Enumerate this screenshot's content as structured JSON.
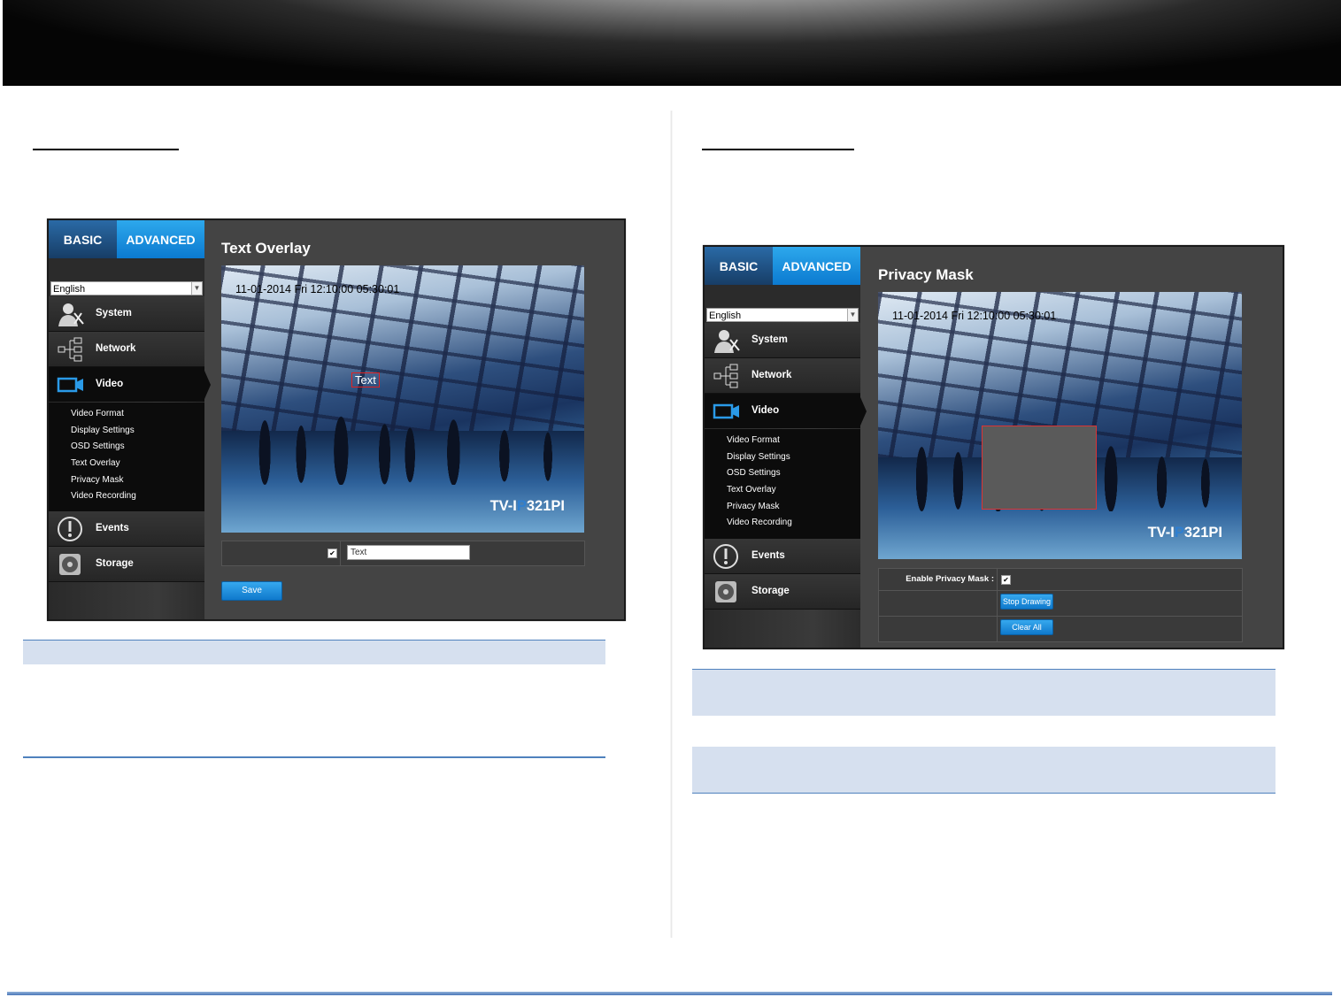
{
  "left_panel": {
    "tabs": {
      "basic": "BASIC",
      "advanced": "ADVANCED"
    },
    "language": "English",
    "menu": {
      "system": "System",
      "network": "Network",
      "video": "Video",
      "events": "Events",
      "storage": "Storage"
    },
    "submenu": [
      "Video Format",
      "Display Settings",
      "OSD Settings",
      "Text Overlay",
      "Privacy Mask",
      "Video Recording"
    ],
    "page_title": "Text Overlay",
    "timestamp": "11-01-2014 Fri 12:10:00 05:30:01",
    "overlay_text": "Text",
    "watermark_prefix": "TV-I",
    "watermark_p": "P",
    "watermark_suffix": "321PI",
    "overlay_enabled_mark": "✔",
    "text_field_value": "Text",
    "save_label": "Save"
  },
  "right_panel": {
    "tabs": {
      "basic": "BASIC",
      "advanced": "ADVANCED"
    },
    "language": "English",
    "menu": {
      "system": "System",
      "network": "Network",
      "video": "Video",
      "events": "Events",
      "storage": "Storage"
    },
    "submenu": [
      "Video Format",
      "Display Settings",
      "OSD Settings",
      "Text Overlay",
      "Privacy Mask",
      "Video Recording"
    ],
    "page_title": "Privacy Mask",
    "timestamp": "11-01-2014 Fri 12:10:00 05:30:01",
    "watermark_prefix": "TV-I",
    "watermark_p": "P",
    "watermark_suffix": "321PI",
    "enable_label": "Enable Privacy Mask :",
    "enable_mark": "✔",
    "stop_drawing_label": "Stop Drawing",
    "clear_all_label": "Clear All"
  },
  "colors": {
    "accent": "#0b7ad0",
    "note_fill": "#d6e0ef",
    "note_rule": "#4f81bd"
  }
}
